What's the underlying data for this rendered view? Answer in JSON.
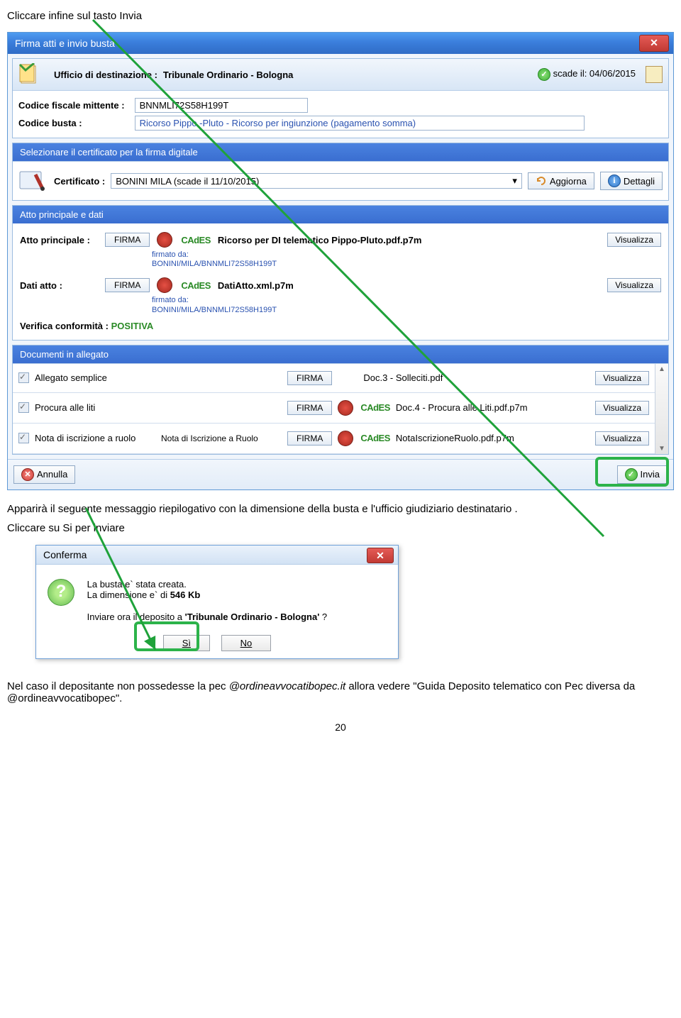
{
  "doc": {
    "instr1": "Cliccare infine sul tasto Invia",
    "text_after_main": "Apparirà il seguente messaggio riepilogativo con la dimensione della busta e l'ufficio giudiziario destinatario .",
    "text_click_si": "Cliccare su Si per inviare",
    "text_footer_1a": "Nel caso il depositante non possedesse la pec ",
    "text_footer_em": "@ordineavvocatibopec.it",
    "text_footer_1b": "  allora vedere \"Guida Deposito telematico con Pec diversa da @ordineavvocatibopec\".",
    "page_number": "20"
  },
  "mainWin": {
    "title": "Firma atti e invio busta",
    "dest_label": "Ufficio di destinazione :",
    "dest_value": "Tribunale Ordinario - Bologna",
    "scade_label": "scade il: 04/06/2015",
    "cf_label": "Codice fiscale mittente :",
    "cf_value": "BNNMLI72S58H199T",
    "cb_label": "Codice  busta :",
    "cb_value": "Ricorso Pippo -Pluto - Ricorso per ingiunzione (pagamento somma)",
    "cert_header": "Selezionare il certificato per la firma digitale",
    "cert_label": "Certificato :",
    "cert_value": "BONINI MILA (scade il 11/10/2015)",
    "aggiorna": "Aggiorna",
    "dettagli": "Dettagli",
    "atto_header": "Atto principale e dati",
    "atto_principale_label": "Atto principale :",
    "firma_btn": "FIRMA",
    "cades": "CAdES",
    "atto_principale_file": "Ricorso per DI telematico Pippo-Pluto.pdf.p7m",
    "firmato_da": "firmato da:",
    "signer": "BONINI/MILA/BNNMLI72S58H199T",
    "dati_atto_label": "Dati atto :",
    "dati_atto_file": "DatiAtto.xml.p7m",
    "verifica_label": "Verifica conformità :",
    "positiva": "POSITIVA",
    "visualizza": "Visualizza",
    "alleg_header": "Documenti in allegato",
    "alleg": [
      {
        "type": "Allegato semplice",
        "extra": "",
        "file": "Doc.3 - Solleciti.pdf",
        "cades": false
      },
      {
        "type": "Procura alle liti",
        "extra": "",
        "file": "Doc.4 - Procura alle Liti.pdf.p7m",
        "cades": true
      },
      {
        "type": "Nota di iscrizione a ruolo",
        "extra": "Nota di Iscrizione a Ruolo",
        "file": "NotaIscrizioneRuolo.pdf.p7m",
        "cades": true
      }
    ],
    "annulla": "Annulla",
    "invia": "Invia"
  },
  "confirm": {
    "title": "Conferma",
    "line1": "La busta e` stata creata.",
    "line2a": "La dimensione e` di ",
    "line2b": "546 Kb",
    "line3a": "Inviare ora il deposito a ",
    "line3b": "'Tribunale Ordinario - Bologna'",
    "line3c": " ?",
    "si": "Sì",
    "no": "No"
  }
}
